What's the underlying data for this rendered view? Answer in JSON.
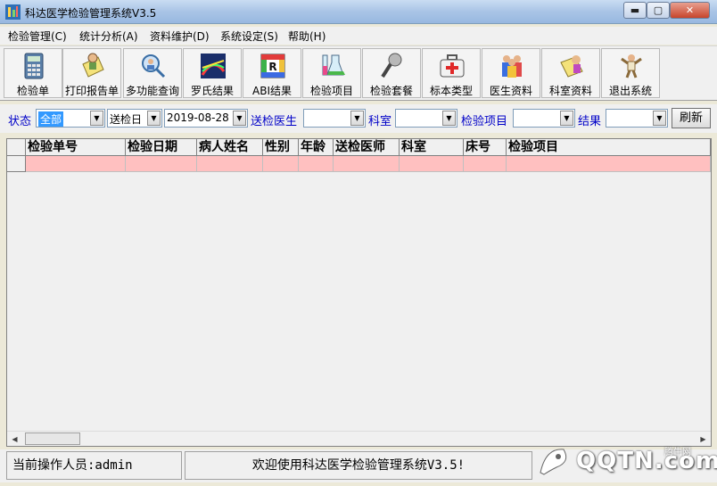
{
  "window": {
    "title": "科达医学检验管理系统V3.5",
    "min_label": "▬",
    "max_label": "▢",
    "close_label": "✕"
  },
  "menu": [
    {
      "label": "检验管理(C)"
    },
    {
      "label": "统计分析(A)"
    },
    {
      "label": "资料维护(D)"
    },
    {
      "label": "系统设定(S)"
    },
    {
      "label": "帮助(H)"
    }
  ],
  "toolbar": [
    {
      "label": "检验单",
      "icon": "calculator-icon"
    },
    {
      "label": "打印报告单",
      "icon": "print-report-icon"
    },
    {
      "label": "多功能查询",
      "icon": "search-people-icon"
    },
    {
      "label": "罗氏结果",
      "icon": "roche-result-icon"
    },
    {
      "label": "ABI结果",
      "icon": "abi-result-icon"
    },
    {
      "label": "检验项目",
      "icon": "flask-icon"
    },
    {
      "label": "检验套餐",
      "icon": "microphone-icon"
    },
    {
      "label": "标本类型",
      "icon": "medical-kit-icon"
    },
    {
      "label": "医生资料",
      "icon": "doctor-icon"
    },
    {
      "label": "科室资料",
      "icon": "department-icon"
    },
    {
      "label": "退出系统",
      "icon": "exit-icon"
    }
  ],
  "filters": {
    "status_label": "状态",
    "status_value": "全部",
    "date_type_value": "送检日",
    "date_value": "2019-08-28",
    "doctor_label": "送检医生",
    "doctor_value": "",
    "dept_label": "科室",
    "dept_value": "",
    "item_label": "检验项目",
    "item_value": "",
    "result_label": "结果",
    "result_value": "",
    "refresh_label": "刷新"
  },
  "grid": {
    "columns": [
      "检验单号",
      "检验日期",
      "病人姓名",
      "性别",
      "年龄",
      "送检医师",
      "科室",
      "床号",
      "检验项目"
    ]
  },
  "status": {
    "operator": "当前操作人员:admin",
    "welcome": "欢迎使用科达医学检验管理系统V3.5!"
  },
  "watermark": {
    "brand": "QQTN.com",
    "sub": "腾牛网"
  }
}
